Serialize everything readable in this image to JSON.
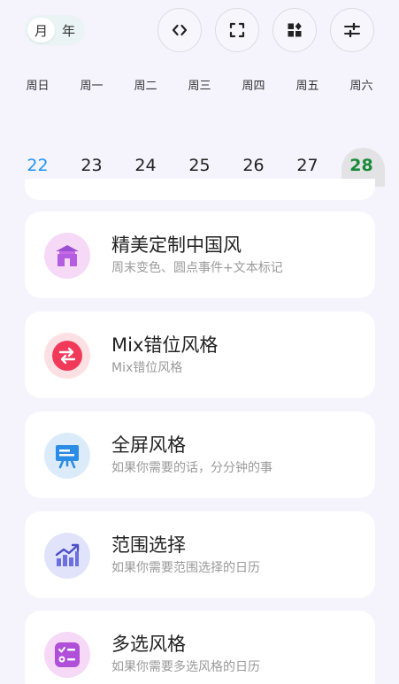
{
  "view_toggle": {
    "month_label": "月",
    "year_label": "年",
    "selected": "月"
  },
  "toolbar_icons": [
    "code-icon",
    "fullscreen-icon",
    "widgets-icon",
    "sliders-icon"
  ],
  "weekdays": [
    "周日",
    "周一",
    "周二",
    "周三",
    "周四",
    "周五",
    "周六"
  ],
  "dates": [
    "22",
    "23",
    "24",
    "25",
    "26",
    "27",
    "28"
  ],
  "today_date": "22",
  "selected_date": "28",
  "colors": {
    "background": "#f5f3fc",
    "today": "#2196f3",
    "selected": "#1a8a3a",
    "selected_bg": "#e3e3e6"
  },
  "cards": [
    {
      "title": "精美定制中国风",
      "subtitle": "周末变色、圆点事件+文本标记",
      "icon": "chinese-pavilion-icon"
    },
    {
      "title": "Mix错位风格",
      "subtitle": "Mix错位风格",
      "icon": "swap-arrows-icon"
    },
    {
      "title": "全屏风格",
      "subtitle": "如果你需要的话，分分钟的事",
      "icon": "presentation-board-icon"
    },
    {
      "title": "范围选择",
      "subtitle": "如果你需要范围选择的日历",
      "icon": "trend-chart-icon"
    },
    {
      "title": "多选风格",
      "subtitle": "如果你需要多选风格的日历",
      "icon": "checklist-icon"
    }
  ]
}
